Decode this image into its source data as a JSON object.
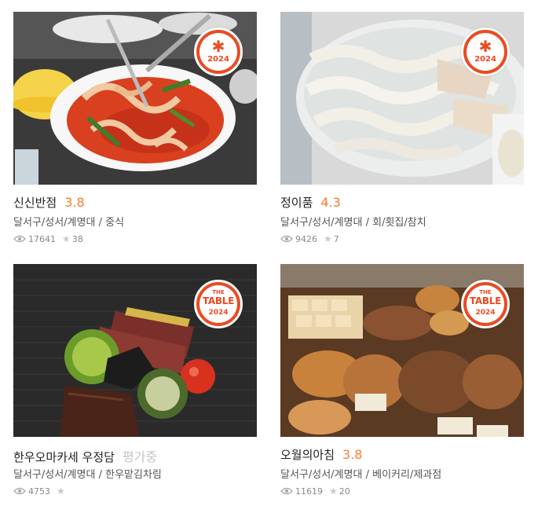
{
  "restaurants": [
    {
      "name": "신신반점",
      "score": "3.8",
      "score_state": "rated",
      "location": "달서구/성서/계명대",
      "category": "중식",
      "views": "17641",
      "reviews": "38",
      "badge": {
        "type": "star",
        "symbol": "✱",
        "year": "2024"
      },
      "photo": "jjamppong"
    },
    {
      "name": "정이품",
      "score": "4.3",
      "score_state": "rated",
      "location": "달서구/성서/계명대",
      "category": "회/횟집/참치",
      "views": "9426",
      "reviews": "7",
      "badge": {
        "type": "star",
        "symbol": "✱",
        "year": "2024"
      },
      "photo": "sashimi"
    },
    {
      "name": "한우오마카세 우정담",
      "score": "평가중",
      "score_state": "pending",
      "location": "달서구/성서/계명대",
      "category": "한우맡김차림",
      "views": "4753",
      "reviews": "",
      "badge": {
        "type": "table",
        "the": "THE",
        "table": "TABLE",
        "year": "2024"
      },
      "photo": "steak"
    },
    {
      "name": "오월의아침",
      "score": "3.8",
      "score_state": "rated",
      "location": "달서구/성서/계명대",
      "category": "베이커리/제과점",
      "views": "11619",
      "reviews": "20",
      "badge": {
        "type": "table",
        "the": "THE",
        "table": "TABLE",
        "year": "2024"
      },
      "photo": "bakery"
    }
  ],
  "separator": " / ",
  "colors": {
    "accent": "#ff792a",
    "badge": "#e94b22",
    "pending": "#c4c4c4"
  }
}
